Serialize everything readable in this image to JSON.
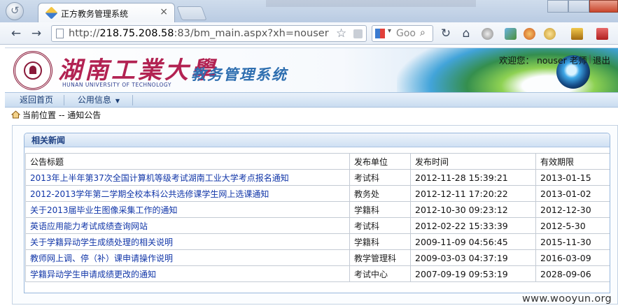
{
  "browser": {
    "tab_title": "正方教务管理系统",
    "tab_close": "×",
    "url_scheme": "http://",
    "url_host": "218.75.208.58",
    "url_rest": ":83/bm_main.aspx?xh=nouser",
    "search_text": "Goo",
    "icons": [
      "back-icon",
      "forward-icon",
      "page-icon",
      "bookmark-star-icon",
      "rss-icon",
      "google-search-icon",
      "magnifier-icon",
      "reload-icon",
      "home-icon",
      "smiley-icon",
      "image-icon",
      "block-icon",
      "face-icon",
      "bee-icon",
      "tools-icon"
    ]
  },
  "header": {
    "university_cn": "湖南工業大學",
    "university_en": "HUNAN UNIVERSITY OF TECHNOLOGY",
    "system_title": "教务管理系统",
    "welcome": "欢迎您： nouser 老师",
    "separator": "|",
    "logout": "退出"
  },
  "menu": {
    "home": "返回首页",
    "public": "公用信息"
  },
  "breadcrumb": {
    "text": "当前位置 -- 通知公告"
  },
  "news": {
    "title": "相关新闻",
    "columns": [
      "公告标题",
      "发布单位",
      "发布时间",
      "有效期限"
    ],
    "rows": [
      [
        "2013年上半年第37次全国计算机等级考试湖南工业大学考点报名通知",
        "考试科",
        "2012-11-28 15:39:21",
        "2013-01-15"
      ],
      [
        "2012-2013学年第二学期全校本科公共选修课学生网上选课通知",
        "教务处",
        "2012-12-11 17:20:22",
        "2013-01-02"
      ],
      [
        "关于2013届毕业生图像采集工作的通知",
        "学籍科",
        "2012-10-30 09:23:12",
        "2012-12-30"
      ],
      [
        "英语应用能力考试成绩查询网站",
        "考试科",
        "2012-02-22 15:33:39",
        "2012-5-30"
      ],
      [
        "关于学籍异动学生成绩处理的相关说明",
        "学籍科",
        "2009-11-09 04:56:45",
        "2015-11-30"
      ],
      [
        "教师网上调、停（补）课申请操作说明",
        "教学管理科",
        "2009-03-03 04:37:19",
        "2016-03-09"
      ],
      [
        "学籍异动学生申请成绩更改的通知",
        "考试中心",
        "2007-09-19 09:53:19",
        "2028-09-06"
      ]
    ]
  },
  "watermark": "www.wooyun.org",
  "colors": {
    "link": "#1136a8",
    "system_title": "#2f6fb0",
    "university": "#b22252",
    "panel_header": "#1c3f82"
  }
}
